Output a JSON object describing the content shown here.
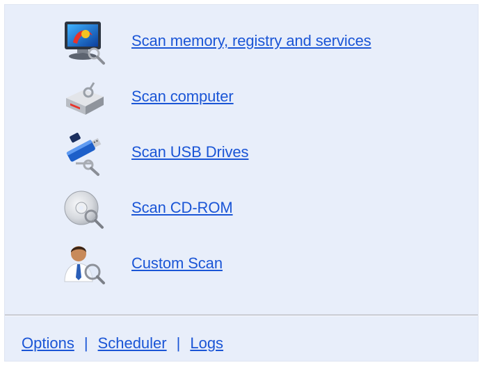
{
  "scan_options": [
    {
      "label": "Scan memory, registry and services",
      "icon": "monitor-magnifier-icon"
    },
    {
      "label": "Scan computer",
      "icon": "computer-drive-icon"
    },
    {
      "label": "Scan USB Drives",
      "icon": "usb-drive-icon"
    },
    {
      "label": "Scan CD-ROM",
      "icon": "cd-rom-icon"
    },
    {
      "label": "Custom Scan",
      "icon": "user-magnifier-icon"
    }
  ],
  "footer": {
    "options_label": "Options",
    "scheduler_label": "Scheduler",
    "logs_label": "Logs",
    "separator": "|"
  },
  "colors": {
    "panel_background": "#e8eefa",
    "link": "#1a55d6"
  }
}
